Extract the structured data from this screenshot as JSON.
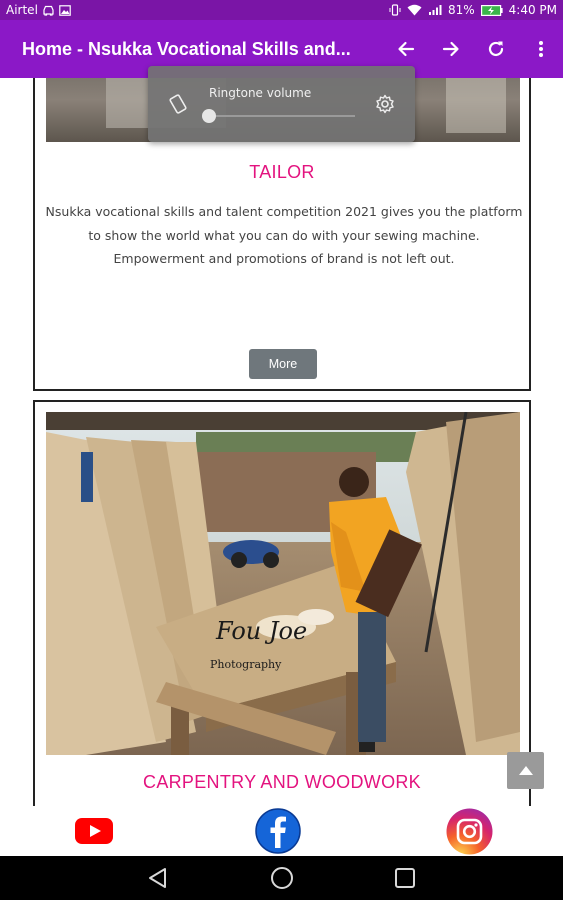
{
  "status_bar": {
    "carrier": "Airtel",
    "battery": "81%",
    "time": "4:40 PM",
    "icons": [
      "car-icon",
      "image-icon",
      "vibrate-icon",
      "wifi-icon",
      "signal-icon",
      "battery-icon"
    ]
  },
  "app_bar": {
    "title": "Home - Nsukka Vocational Skills and...",
    "actions": [
      "back-arrow-icon",
      "forward-arrow-icon",
      "refresh-icon",
      "more-vert-icon"
    ],
    "color": "#8b18c7"
  },
  "volume_popup": {
    "label": "Ringtone volume",
    "level": 0
  },
  "cards": [
    {
      "title": "TAILOR",
      "description": "Nsukka vocational skills and talent competition 2021 gives you the platform to show the world what you can do with your sewing machine. Empowerment and promotions of brand is not left out.",
      "button_label": "More"
    },
    {
      "title": "CARPENTRY AND WOODWORK",
      "watermark_line1": "Fou Joe",
      "watermark_line2": "Photography"
    }
  ],
  "social": [
    "youtube-icon",
    "facebook-icon",
    "instagram-icon"
  ],
  "nav": [
    "back-triangle-icon",
    "home-circle-icon",
    "recents-square-icon"
  ],
  "colors": {
    "accent_title": "#e3137f",
    "button": "#6f777c"
  }
}
